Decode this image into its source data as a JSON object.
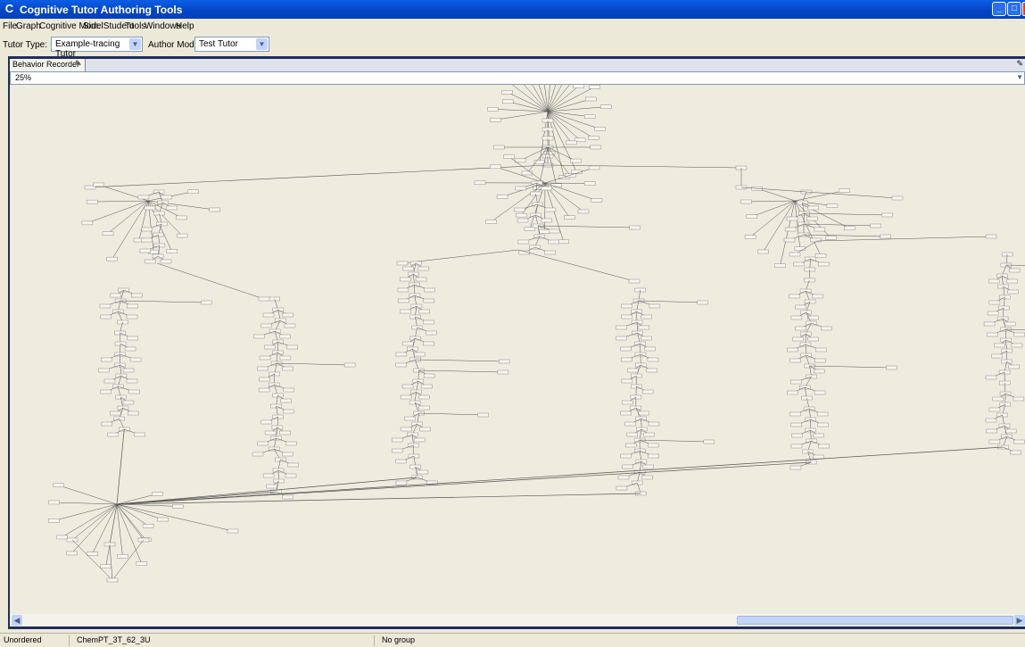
{
  "window": {
    "title": "Cognitive Tutor Authoring Tools",
    "icon": "app-c-icon"
  },
  "menu": [
    "File",
    "Graph",
    "Cognitive Model",
    "Sim. Student",
    "Tools",
    "Windows",
    "Help"
  ],
  "toolbar": {
    "tutor_type_label": "Tutor Type:",
    "tutor_type_value": "Example-tracing Tutor",
    "author_mode_label": "Author Mode:",
    "author_mode_value": "Test Tutor"
  },
  "panel": {
    "tab_label": "Behavior Recorder",
    "zoom": "25%"
  },
  "status": {
    "ordering": "Unordered",
    "problem": "ChemPT_3T_62_3U",
    "group": "No group"
  },
  "colors": {
    "titlebar": "#0a5ee4",
    "canvas": "#eeecdf",
    "frame": "#1f2f5c"
  }
}
